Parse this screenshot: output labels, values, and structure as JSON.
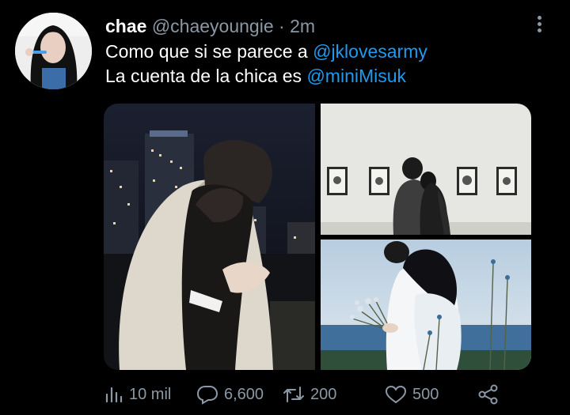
{
  "tweet": {
    "display_name": "chae",
    "handle": "@chaeyoungie",
    "separator": "·",
    "time": "2m",
    "text_line1": "Como que si se parece a ",
    "mention1": "@jklovesarmy",
    "text_line2": "La cuenta de la chica es ",
    "mention2": "@miniMisuk"
  },
  "media": {
    "photos": [
      {
        "name": "night-hug-photo"
      },
      {
        "name": "gallery-photo"
      },
      {
        "name": "flowers-photo"
      }
    ]
  },
  "actions": {
    "views": "10 mil",
    "replies": "6,600",
    "retweets": "200",
    "likes": "500"
  },
  "icons": {
    "views": "bar-chart-icon",
    "reply": "reply-bubble-icon",
    "retweet": "retweet-icon",
    "like": "heart-icon",
    "share": "share-icon",
    "more": "more-dots-icon"
  },
  "colors": {
    "background": "#000000",
    "text": "#ffffff",
    "muted": "#8b98a5",
    "link": "#1d9bf0"
  }
}
